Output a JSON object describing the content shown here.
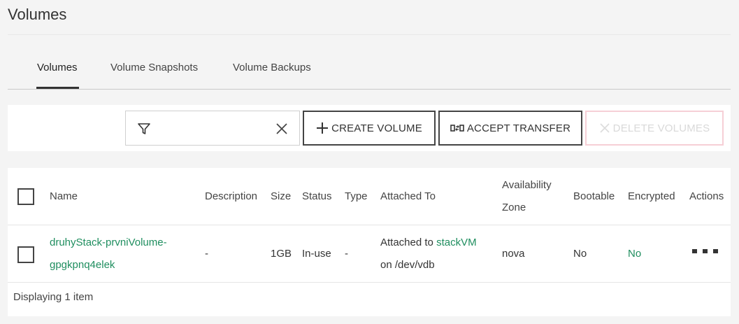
{
  "page": {
    "title": "Volumes"
  },
  "tabs": [
    {
      "label": "Volumes",
      "active": true
    },
    {
      "label": "Volume Snapshots",
      "active": false
    },
    {
      "label": "Volume Backups",
      "active": false
    }
  ],
  "toolbar": {
    "filter_value": "",
    "create_label": "CREATE VOLUME",
    "accept_label": "ACCEPT TRANSFER",
    "delete_label": "DELETE VOLUMES"
  },
  "table": {
    "headers": {
      "name": "Name",
      "description": "Description",
      "size": "Size",
      "status": "Status",
      "type": "Type",
      "attached_to": "Attached To",
      "az_line1": "Availability",
      "az_line2": "Zone",
      "bootable": "Bootable",
      "encrypted": "Encrypted",
      "actions": "Actions"
    },
    "rows": [
      {
        "name_line1": "druhyStack-prvniVolume-",
        "name_line2": "gpgkpnq4elek",
        "description": "-",
        "size": "1GB",
        "status": "In-use",
        "type": "-",
        "attached_prefix": "Attached to",
        "attached_vm": "stackVM",
        "attached_device": "on /dev/vdb",
        "availability_zone": "nova",
        "bootable": "No",
        "encrypted": "No"
      }
    ],
    "footer": "Displaying 1 item"
  },
  "colors": {
    "link": "#1f8e5f",
    "delete_border": "#f6cfd6",
    "disabled_text": "#d9d9d9"
  }
}
